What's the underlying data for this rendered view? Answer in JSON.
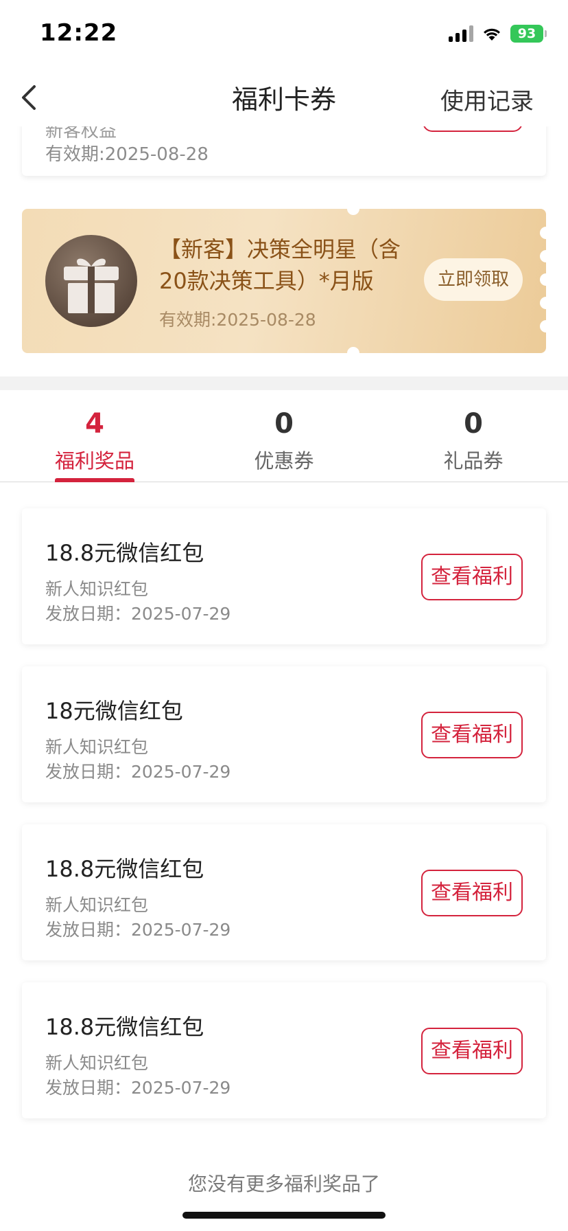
{
  "status_bar": {
    "time": "12:22",
    "battery": "93"
  },
  "nav": {
    "title": "福利卡券",
    "right_label": "使用记录"
  },
  "top_card": {
    "partial_title": "新客权益",
    "validity": "有效期:2025-08-28"
  },
  "gold_coupon": {
    "title": "【新客】决策全明星（含20款决策工具）*月版",
    "validity": "有效期:2025-08-28",
    "button": "立即领取"
  },
  "tabs": [
    {
      "count": "4",
      "label": "福利奖品",
      "active": true
    },
    {
      "count": "0",
      "label": "优惠券",
      "active": false
    },
    {
      "count": "0",
      "label": "礼品券",
      "active": false
    }
  ],
  "benefits": [
    {
      "title": "18.8元微信红包",
      "subtitle": "新人知识红包",
      "date_label": "发放日期：",
      "date": "2025-07-29",
      "button": "查看福利"
    },
    {
      "title": "18元微信红包",
      "subtitle": "新人知识红包",
      "date_label": "发放日期：",
      "date": "2025-07-29",
      "button": "查看福利"
    },
    {
      "title": "18.8元微信红包",
      "subtitle": "新人知识红包",
      "date_label": "发放日期：",
      "date": "2025-07-29",
      "button": "查看福利"
    },
    {
      "title": "18.8元微信红包",
      "subtitle": "新人知识红包",
      "date_label": "发放日期：",
      "date": "2025-07-29",
      "button": "查看福利"
    }
  ],
  "footer": {
    "no_more": "您没有更多福利奖品了"
  },
  "colors": {
    "accent": "#d4233d",
    "gold_text": "#8a5218",
    "battery": "#34c759"
  }
}
